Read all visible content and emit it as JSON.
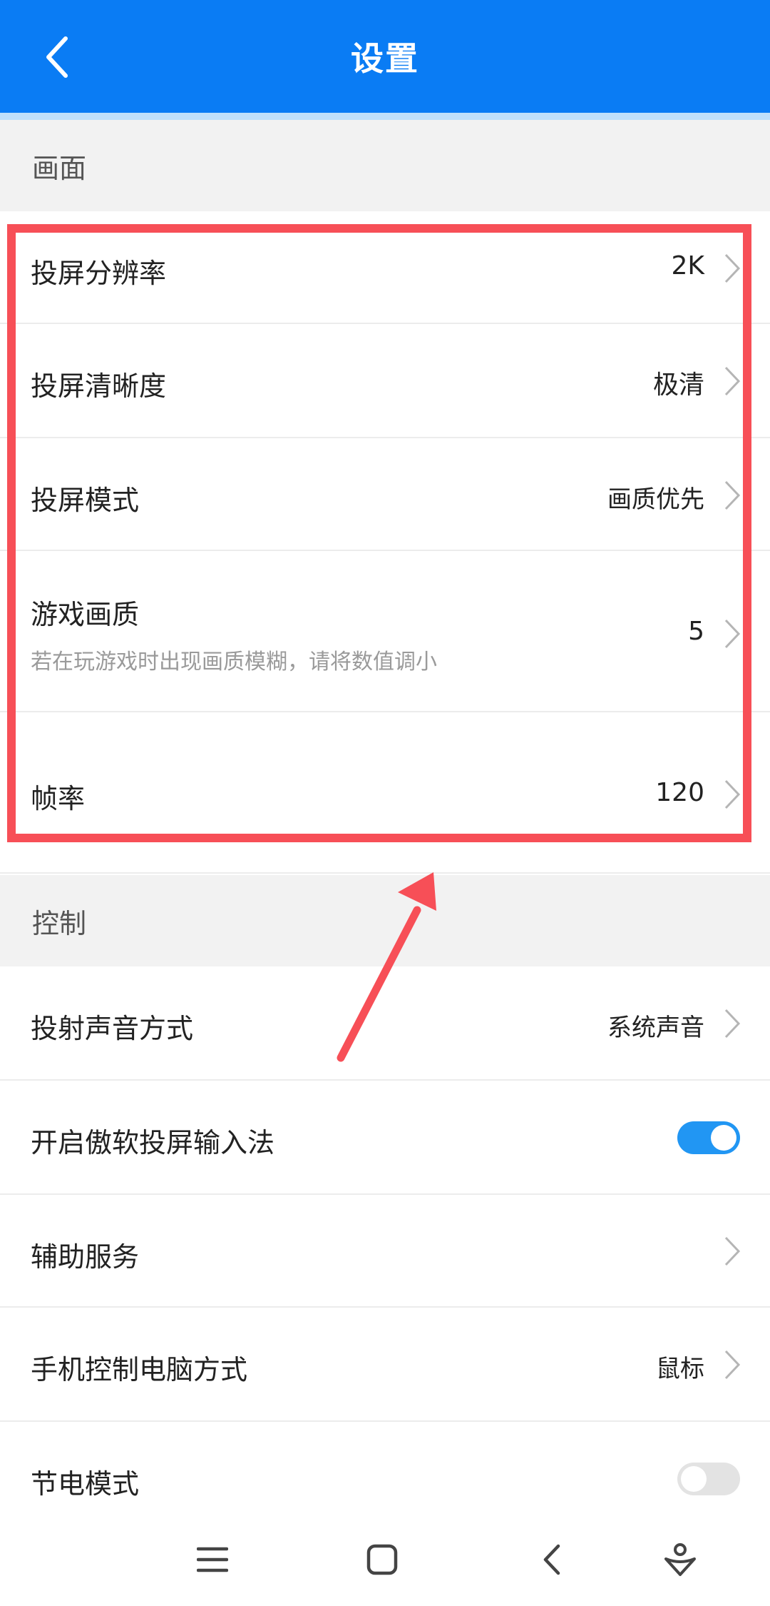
{
  "header": {
    "title": "设置",
    "back_icon": "chevron-left-icon"
  },
  "sections": {
    "display": {
      "title": "画面"
    },
    "control": {
      "title": "控制"
    }
  },
  "display_rows": {
    "resolution": {
      "label": "投屏分辨率",
      "value": "2K"
    },
    "clarity": {
      "label": "投屏清晰度",
      "value": "极清"
    },
    "mode": {
      "label": "投屏模式",
      "value": "画质优先"
    },
    "game_quality": {
      "label": "游戏画质",
      "subtitle": "若在玩游戏时出现画质模糊，请将数值调小",
      "value": "5"
    },
    "frame_rate": {
      "label": "帧率",
      "value": "120"
    }
  },
  "control_rows": {
    "sound": {
      "label": "投射声音方式",
      "value": "系统声音"
    },
    "input_method": {
      "label": "开启傲软投屏输入法",
      "toggle": true
    },
    "assist": {
      "label": "辅助服务"
    },
    "phone_control": {
      "label": "手机控制电脑方式",
      "value": "鼠标"
    },
    "power_save": {
      "label": "节电模式",
      "toggle": false
    }
  },
  "colors": {
    "header_bg": "#0a7cf4",
    "highlight": "#f74f57",
    "toggle_on": "#2196f3",
    "toggle_off": "#e3e3e3"
  },
  "nav_bar": {
    "icons": [
      "menu-icon",
      "home-square-icon",
      "back-chevron-icon",
      "assistant-icon"
    ]
  }
}
